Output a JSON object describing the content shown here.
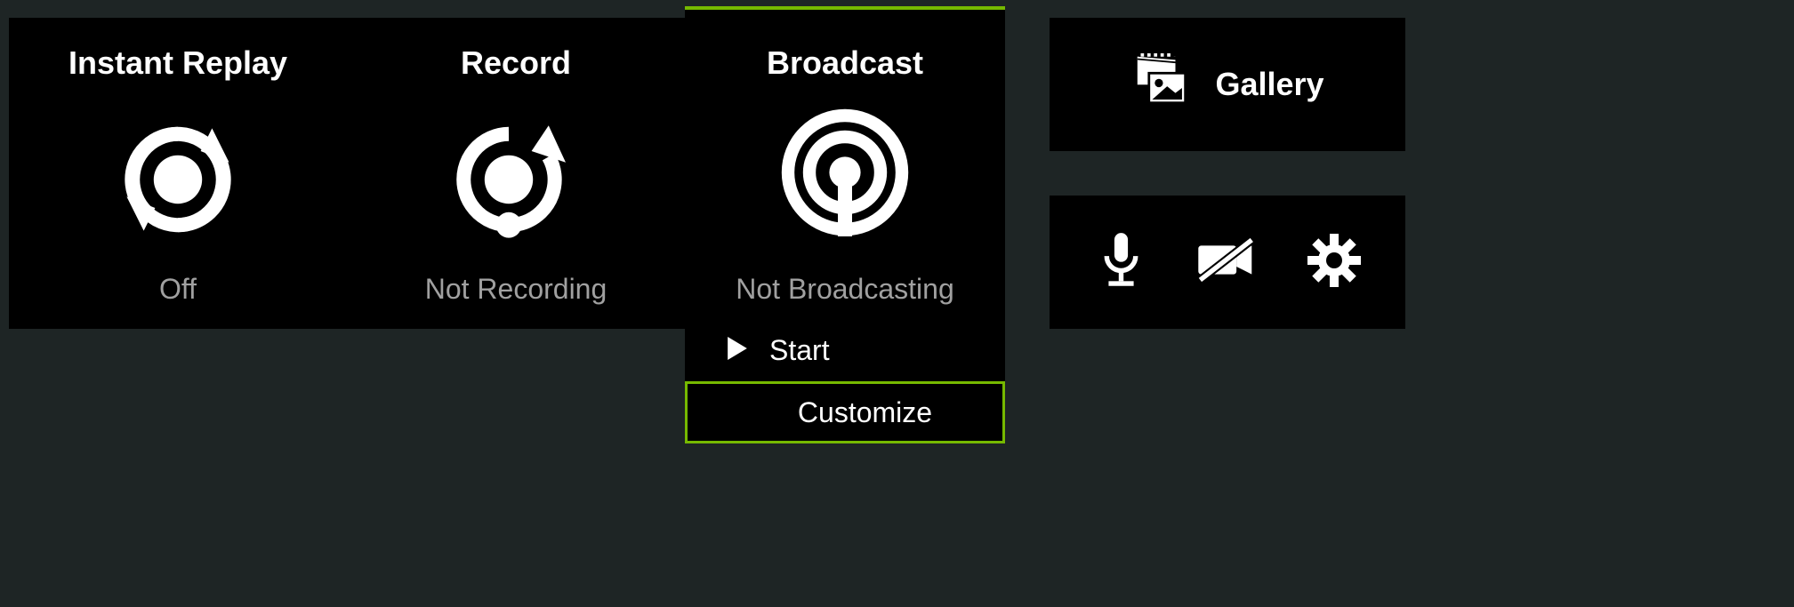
{
  "tiles": {
    "instantReplay": {
      "title": "Instant Replay",
      "status": "Off"
    },
    "record": {
      "title": "Record",
      "status": "Not Recording"
    },
    "broadcast": {
      "title": "Broadcast",
      "status": "Not Broadcasting"
    }
  },
  "broadcastMenu": {
    "start": "Start",
    "customize": "Customize"
  },
  "sidebar": {
    "gallery": "Gallery"
  },
  "accentColor": "#76b900"
}
